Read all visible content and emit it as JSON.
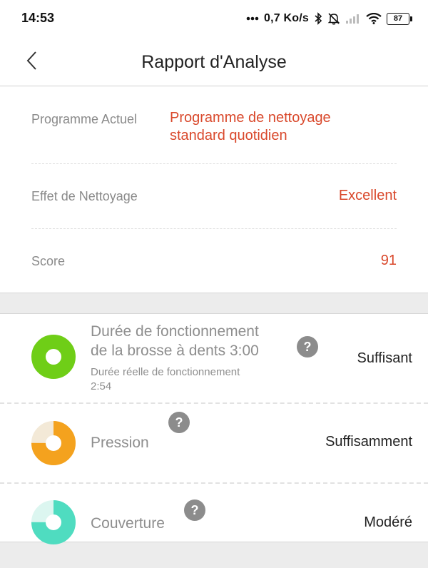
{
  "status_bar": {
    "time": "14:53",
    "net_speed": "0,7 Ko/s",
    "battery": "87",
    "icons": [
      "more-dots-icon",
      "bluetooth-icon",
      "bell-muted-icon",
      "cell-signal-icon",
      "wifi-icon",
      "battery-icon"
    ]
  },
  "header": {
    "title": "Rapport d'Analyse",
    "back_icon": "chevron-left-icon"
  },
  "summary": {
    "program_label": "Programme Actuel",
    "program_value_line1": "Programme de nettoyage",
    "program_value_line2": "standard quotidien",
    "effect_label": "Effet de Nettoyage",
    "effect_value": "Excellent",
    "score_label": "Score",
    "score_value": "91"
  },
  "metrics": [
    {
      "title_line1": "Durée de fonctionnement",
      "title_line2": "de la brosse à dents 3:00",
      "sub_line1": "Durée réelle de fonctionnement",
      "sub_line2": "2:54",
      "status": "Suffisant",
      "color": "#6fce17",
      "fraction": 1.0,
      "help_label": "?"
    },
    {
      "title": "Pression",
      "status": "Suffisamment",
      "color": "#f4a21e",
      "track_color": "#f3e9d7",
      "fraction": 0.75,
      "help_label": "?"
    },
    {
      "title": "Couverture",
      "status": "Modéré",
      "color": "#4fdcc0",
      "track_color": "#dcf6f0",
      "fraction": 0.75,
      "help_label": "?"
    }
  ],
  "colors": {
    "accent": "#d9482b",
    "label_grey": "#8a8a8a",
    "background": "#ececec"
  }
}
